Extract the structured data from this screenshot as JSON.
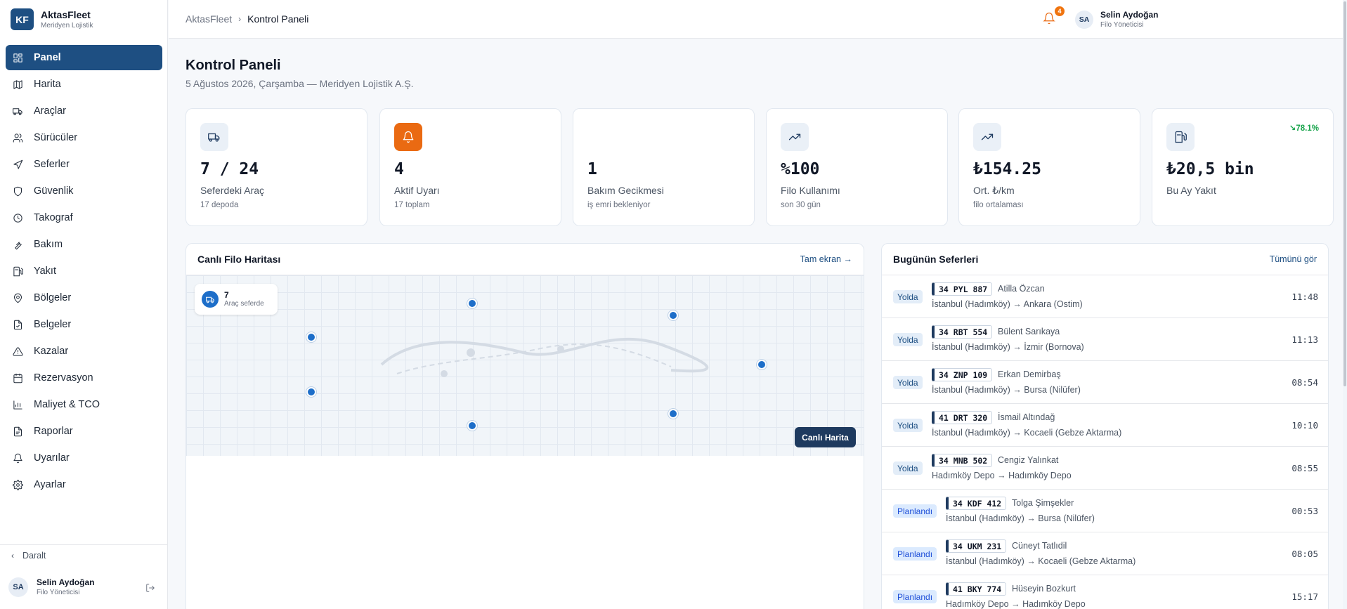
{
  "brand": {
    "logo": "KF",
    "name": "AktasFleet",
    "subtitle": "Meridyen Lojistik"
  },
  "nav": [
    {
      "label": "Panel",
      "icon": "dashboard-icon",
      "active": true
    },
    {
      "label": "Harita",
      "icon": "map-icon"
    },
    {
      "label": "Araçlar",
      "icon": "truck-icon"
    },
    {
      "label": "Sürücüler",
      "icon": "users-icon"
    },
    {
      "label": "Seferler",
      "icon": "navigation-icon"
    },
    {
      "label": "Güvenlik",
      "icon": "shield-icon"
    },
    {
      "label": "Takograf",
      "icon": "clock-icon"
    },
    {
      "label": "Bakım",
      "icon": "wrench-icon"
    },
    {
      "label": "Yakıt",
      "icon": "fuel-icon"
    },
    {
      "label": "Bölgeler",
      "icon": "map-pin-icon"
    },
    {
      "label": "Belgeler",
      "icon": "file-icon"
    },
    {
      "label": "Kazalar",
      "icon": "alert-triangle-icon"
    },
    {
      "label": "Rezervasyon",
      "icon": "calendar-icon"
    },
    {
      "label": "Maliyet & TCO",
      "icon": "bar-chart-icon"
    },
    {
      "label": "Raporlar",
      "icon": "report-icon"
    },
    {
      "label": "Uyarılar",
      "icon": "bell-icon"
    },
    {
      "label": "Ayarlar",
      "icon": "gear-icon"
    }
  ],
  "sidebar_footer": {
    "collapse_label": "Daralt",
    "user_initials": "SA",
    "user_name": "Selin Aydoğan",
    "user_role": "Filo Yöneticisi"
  },
  "topbar": {
    "breadcrumb": [
      "AktasFleet",
      "Kontrol Paneli"
    ],
    "notification_count": "4",
    "user_initials": "SA",
    "user_name": "Selin Aydoğan",
    "user_role": "Filo Yöneticisi"
  },
  "page": {
    "title": "Kontrol Paneli",
    "subtitle": "5 Ağustos 2026, Çarşamba — Meridyen Lojistik A.Ş."
  },
  "stats": [
    {
      "icon": "truck-icon",
      "value": "7 / 24",
      "label": "Seferdeki Araç",
      "sub": "17 depoda"
    },
    {
      "icon": "bell-icon",
      "value": "4",
      "label": "Aktif Uyarı",
      "sub": "17 toplam"
    },
    {
      "icon": "",
      "value": "1",
      "label": "Bakım Gecikmesi",
      "sub": "iş emri bekleniyor"
    },
    {
      "icon": "trending-up-icon",
      "value": "%100",
      "label": "Filo Kullanımı",
      "sub": "son 30 gün"
    },
    {
      "icon": "trending-up-icon",
      "value": "₺154.25",
      "label": "Ort. ₺/km",
      "sub": "filo ortalaması"
    },
    {
      "icon": "fuel-icon",
      "value": "₺20,5 bin",
      "label": "Bu Ay Yakıt",
      "sub": "",
      "trend": "↘78.1%"
    }
  ],
  "map": {
    "title": "Canlı Filo Haritası",
    "fullscreen_label": "Tam ekran →",
    "vehicle_count": "7",
    "vehicle_count_label": "Araç seferde",
    "live_button": "Canlı Harita"
  },
  "trips": {
    "title": "Bugünün Seferleri",
    "see_all": "Tümünü gör",
    "items": [
      {
        "status": "Yolda",
        "plate": "34 PYL 887",
        "driver": "Atilla Özcan",
        "route": "İstanbul (Hadımköy) → Ankara (Ostim)",
        "time": "11:48"
      },
      {
        "status": "Yolda",
        "plate": "34 RBT 554",
        "driver": "Bülent Sarıkaya",
        "route": "İstanbul (Hadımköy) → İzmir (Bornova)",
        "time": "11:13"
      },
      {
        "status": "Yolda",
        "plate": "34 ZNP 109",
        "driver": "Erkan Demirbaş",
        "route": "İstanbul (Hadımköy) → Bursa (Nilüfer)",
        "time": "08:54"
      },
      {
        "status": "Yolda",
        "plate": "41 DRT 320",
        "driver": "İsmail Altındağ",
        "route": "İstanbul (Hadımköy) → Kocaeli (Gebze Aktarma)",
        "time": "10:10"
      },
      {
        "status": "Yolda",
        "plate": "34 MNB 502",
        "driver": "Cengiz Yalınkat",
        "route": "Hadımköy Depo → Hadımköy Depo",
        "time": "08:55"
      },
      {
        "status": "Planlandı",
        "plate": "34 KDF 412",
        "driver": "Tolga Şimşekler",
        "route": "İstanbul (Hadımköy) → Bursa (Nilüfer)",
        "time": "00:53"
      },
      {
        "status": "Planlandı",
        "plate": "34 UKM 231",
        "driver": "Cüneyt Tatlıdil",
        "route": "İstanbul (Hadımköy) → Kocaeli (Gebze Aktarma)",
        "time": "08:05"
      },
      {
        "status": "Planlandı",
        "plate": "41 BKY 774",
        "driver": "Hüseyin Bozkurt",
        "route": "Hadımköy Depo → Hadımköy Depo",
        "time": "15:17"
      }
    ]
  },
  "colors": {
    "primary": "#1e4f82",
    "accent": "#ea6a12",
    "success": "#16a34a",
    "pin": "#1d6ec9"
  }
}
